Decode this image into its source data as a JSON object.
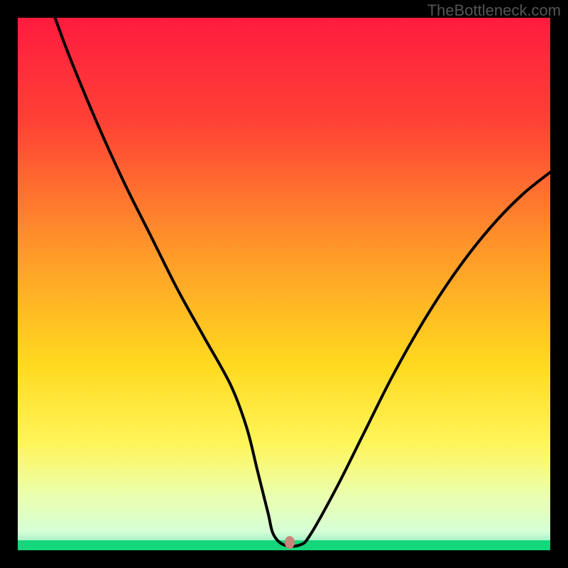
{
  "watermark": "TheBottleneck.com",
  "chart_data": {
    "type": "line",
    "title": "",
    "xlabel": "",
    "ylabel": "",
    "xlim": [
      0,
      100
    ],
    "ylim": [
      0,
      100
    ],
    "grid": false,
    "legend": false,
    "background_gradient": {
      "stops": [
        {
          "pos": 0.0,
          "color": "#ff1b3f"
        },
        {
          "pos": 0.2,
          "color": "#ff4335"
        },
        {
          "pos": 0.45,
          "color": "#ff9c29"
        },
        {
          "pos": 0.65,
          "color": "#ffd91e"
        },
        {
          "pos": 0.8,
          "color": "#fff55a"
        },
        {
          "pos": 0.9,
          "color": "#eaffb0"
        },
        {
          "pos": 0.965,
          "color": "#d6ffd6"
        },
        {
          "pos": 0.985,
          "color": "#9ff0c8"
        },
        {
          "pos": 1.0,
          "color": "#14d67a"
        }
      ]
    },
    "series": [
      {
        "name": "curve",
        "color": "#000000",
        "x": [
          7,
          10,
          15,
          20,
          25,
          30,
          35,
          40,
          43,
          45,
          47,
          48,
          50,
          53,
          55,
          60,
          65,
          70,
          75,
          80,
          85,
          90,
          95,
          100
        ],
        "y": [
          100,
          92,
          80,
          69,
          59,
          49,
          40,
          31,
          23,
          15,
          7,
          3,
          1,
          1,
          3,
          12,
          22,
          32,
          41,
          49,
          56,
          62,
          67,
          71
        ]
      }
    ],
    "marker": {
      "x": 51,
      "y": 1.5,
      "color": "#c98578"
    }
  }
}
